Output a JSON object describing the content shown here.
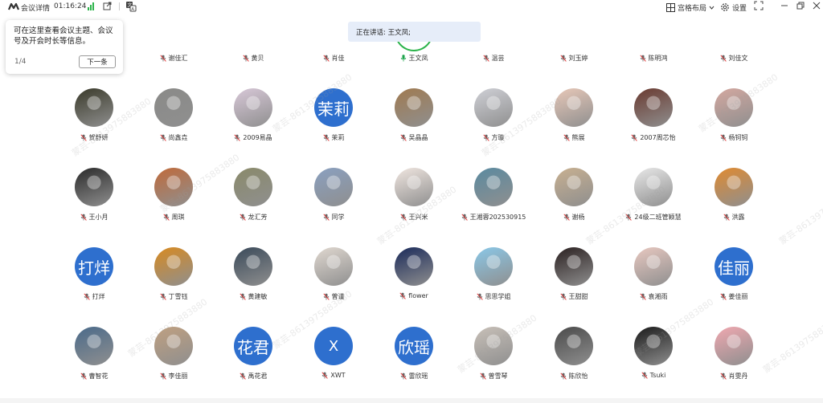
{
  "topbar": {
    "title": "会议详情",
    "time": "01:16:24",
    "grid_layout_label": "宫格布局",
    "settings_label": "设置"
  },
  "tooltip": {
    "message": "可在这里查看会议主题、会议号及开会时长等信息。",
    "page": "1/4",
    "next_label": "下一条"
  },
  "speaking": "正在讲话: 王文凤;",
  "watermark": "蒙芸-8613975883880",
  "first_row": [
    "谢佳汇",
    "黄贝",
    "肖佳",
    "王文凤",
    "温芸",
    "刘玉婷",
    "陈明鸿",
    "刘佳文"
  ],
  "rows": [
    [
      {
        "name": "贺舒妍",
        "avatar": "photo",
        "color": "#3a3a2a"
      },
      {
        "name": "尚鑫垚",
        "avatar": "photo",
        "color": "#8a8a88"
      },
      {
        "name": "2009易晶",
        "avatar": "photo",
        "color": "#d8c8d8"
      },
      {
        "name": "茉莉",
        "avatar": "text",
        "text": "茉莉"
      },
      {
        "name": "吴晶晶",
        "avatar": "photo",
        "color": "#a07a50"
      },
      {
        "name": "方璇",
        "avatar": "photo",
        "color": "#cfd0d6"
      },
      {
        "name": "熊展",
        "avatar": "photo",
        "color": "#e8c8b8"
      },
      {
        "name": "2007周芯怡",
        "avatar": "photo",
        "color": "#6a3a30"
      },
      {
        "name": "杨钶钶",
        "avatar": "photo",
        "color": "#d4a8a0"
      }
    ],
    [
      {
        "name": "王小月",
        "avatar": "photo",
        "color": "#2a2a2a"
      },
      {
        "name": "周琪",
        "avatar": "photo",
        "color": "#c06a3a"
      },
      {
        "name": "龙汇芳",
        "avatar": "photo",
        "color": "#8a8a6a"
      },
      {
        "name": "同学",
        "avatar": "photo",
        "color": "#8aa0c0"
      },
      {
        "name": "王兴米",
        "avatar": "photo",
        "color": "#f0e6e0"
      },
      {
        "name": "王湘蓉202530915",
        "avatar": "photo",
        "color": "#5a8aa0"
      },
      {
        "name": "谢杨",
        "avatar": "photo",
        "color": "#c8b090"
      },
      {
        "name": "24级二班管颖慧",
        "avatar": "photo",
        "color": "#e8e8e8"
      },
      {
        "name": "洪露",
        "avatar": "photo",
        "color": "#e08a30"
      }
    ],
    [
      {
        "name": "打烊",
        "avatar": "text",
        "text": "打烊"
      },
      {
        "name": "丁雪钰",
        "avatar": "photo",
        "color": "#d88a20"
      },
      {
        "name": "黄建敏",
        "avatar": "photo",
        "color": "#3a4a5a"
      },
      {
        "name": "曾谨",
        "avatar": "photo",
        "color": "#e0d8d0"
      },
      {
        "name": "flower",
        "avatar": "photo",
        "color": "#1a2a5a"
      },
      {
        "name": "思思学姐",
        "avatar": "photo",
        "color": "#8ac8e8"
      },
      {
        "name": "王甜甜",
        "avatar": "photo",
        "color": "#2a2020"
      },
      {
        "name": "袁湘雨",
        "avatar": "photo",
        "color": "#e8c8c0"
      },
      {
        "name": "姜佳丽",
        "avatar": "text",
        "text": "佳丽"
      }
    ],
    [
      {
        "name": "曹智花",
        "avatar": "photo",
        "color": "#4a6a8a"
      },
      {
        "name": "李佳丽",
        "avatar": "photo",
        "color": "#c0a080"
      },
      {
        "name": "禹花君",
        "avatar": "text",
        "text": "花君"
      },
      {
        "name": "XWT",
        "avatar": "text",
        "text": "X"
      },
      {
        "name": "雷欣瑶",
        "avatar": "text",
        "text": "欣瑶"
      },
      {
        "name": "曾雪琴",
        "avatar": "photo",
        "color": "#c8c0b8"
      },
      {
        "name": "陈欣怡",
        "avatar": "photo",
        "color": "#4a4a4a"
      },
      {
        "name": "Tsuki",
        "avatar": "photo",
        "color": "#1a1a1a"
      },
      {
        "name": "肖雯丹",
        "avatar": "photo",
        "color": "#f0a8b0"
      }
    ]
  ]
}
